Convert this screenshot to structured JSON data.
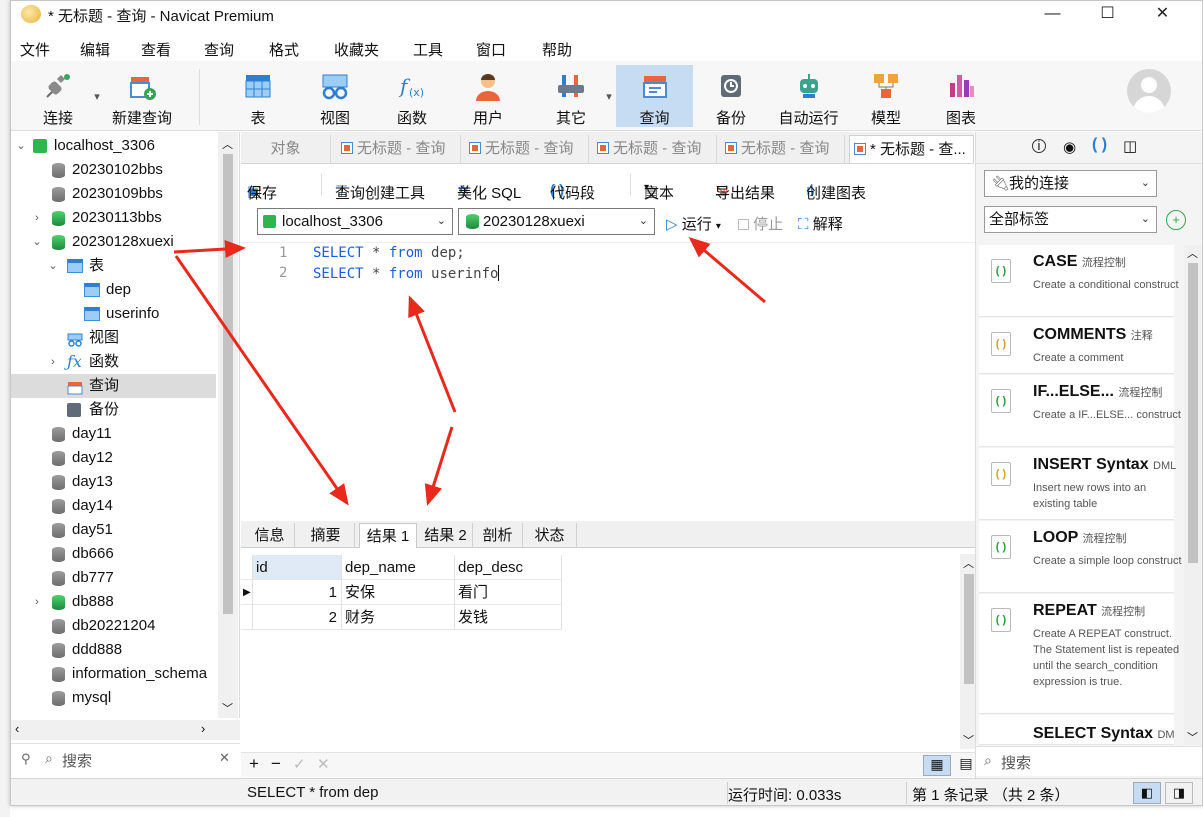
{
  "window": {
    "title": "* 无标题 - 查询 - Navicat Premium",
    "controls": [
      "—",
      "☐",
      "✕"
    ]
  },
  "menu": [
    "文件",
    "编辑",
    "查看",
    "查询",
    "格式",
    "收藏夹",
    "工具",
    "窗口",
    "帮助"
  ],
  "toolbar": [
    {
      "label": "连接",
      "icon": "plug-icon"
    },
    {
      "label": "新建查询",
      "icon": "new-query-icon"
    },
    {
      "label": "表",
      "icon": "table-icon"
    },
    {
      "label": "视图",
      "icon": "view-icon"
    },
    {
      "label": "函数",
      "icon": "function-icon"
    },
    {
      "label": "用户",
      "icon": "user-icon"
    },
    {
      "label": "其它",
      "icon": "tools-icon"
    },
    {
      "label": "查询",
      "icon": "query-icon"
    },
    {
      "label": "备份",
      "icon": "backup-icon"
    },
    {
      "label": "自动运行",
      "icon": "robot-icon"
    },
    {
      "label": "模型",
      "icon": "model-icon"
    },
    {
      "label": "图表",
      "icon": "chart-icon"
    }
  ],
  "tree": {
    "connection": "localhost_3306",
    "items": [
      {
        "label": "20230102bbs"
      },
      {
        "label": "20230109bbs"
      },
      {
        "label": "20230113bbs"
      },
      {
        "label": "20230128xuexi"
      },
      {
        "label": "表"
      },
      {
        "label": "dep"
      },
      {
        "label": "userinfo"
      },
      {
        "label": "视图"
      },
      {
        "label": "函数"
      },
      {
        "label": "查询"
      },
      {
        "label": "备份"
      },
      {
        "label": "day11"
      },
      {
        "label": "day12"
      },
      {
        "label": "day13"
      },
      {
        "label": "day14"
      },
      {
        "label": "day51"
      },
      {
        "label": "db666"
      },
      {
        "label": "db777"
      },
      {
        "label": "db888"
      },
      {
        "label": "db20221204"
      },
      {
        "label": "ddd888"
      },
      {
        "label": "information_schema"
      },
      {
        "label": "mysql"
      }
    ],
    "search_placeholder": "搜索"
  },
  "tabs": [
    "对象",
    "无标题 - 查询",
    "无标题 - 查询",
    "无标题 - 查询",
    "无标题 - 查询",
    "* 无标题 - 查..."
  ],
  "query_toolbar": {
    "save": "保存",
    "builder": "查询创建工具",
    "beautify": "美化 SQL",
    "snippet": "代码段",
    "text": "文本",
    "export": "导出结果",
    "chart": "创建图表"
  },
  "selectors": {
    "connection": "localhost_3306",
    "database": "20230128xuexi",
    "run": "运行",
    "stop": "停止",
    "explain": "解释"
  },
  "editor": {
    "lines": [
      {
        "no": "1",
        "kw1": "SELECT",
        "mid": " * ",
        "kw2": "from",
        "rest": " dep;"
      },
      {
        "no": "2",
        "kw1": "SELECT",
        "mid": " * ",
        "kw2": "from",
        "rest": " userinfo"
      }
    ]
  },
  "result_tabs": [
    "信息",
    "摘要",
    "结果 1",
    "结果 2",
    "剖析",
    "状态"
  ],
  "result": {
    "columns": [
      "id",
      "dep_name",
      "dep_desc"
    ],
    "rows": [
      [
        "1",
        "安保",
        "看门"
      ],
      [
        "2",
        "财务",
        "发钱"
      ]
    ]
  },
  "grid_bottom": [
    "+",
    "−",
    "✓",
    "✕"
  ],
  "status": {
    "sql": "SELECT * from dep",
    "time": "运行时间: 0.033s",
    "records": "第 1 条记录 （共 2 条）"
  },
  "snippets_panel": {
    "connection_select": "我的连接",
    "tag_select": "全部标签",
    "search_placeholder": "搜索",
    "items": [
      {
        "title": "CASE",
        "tag": "流程控制",
        "desc": "Create a conditional construct"
      },
      {
        "title": "COMMENTS",
        "tag": "注释",
        "desc": "Create a comment"
      },
      {
        "title": "IF...ELSE...",
        "tag": "流程控制",
        "desc": "Create a IF...ELSE... construct"
      },
      {
        "title": "INSERT Syntax",
        "tag": "DML",
        "desc": "Insert new rows into an existing table"
      },
      {
        "title": "LOOP",
        "tag": "流程控制",
        "desc": "Create a simple loop construct"
      },
      {
        "title": "REPEAT",
        "tag": "流程控制",
        "desc": "Create A REPEAT construct. The Statement list is repeated until the search_condition expression is true."
      },
      {
        "title": "SELECT Syntax",
        "tag": "DML",
        "desc": ""
      }
    ]
  },
  "colors": {
    "accent": "#2e7fd1",
    "active_toolbar": "#c6dcf2",
    "annotation": "#e8291c",
    "db_active": "#2db64d"
  }
}
